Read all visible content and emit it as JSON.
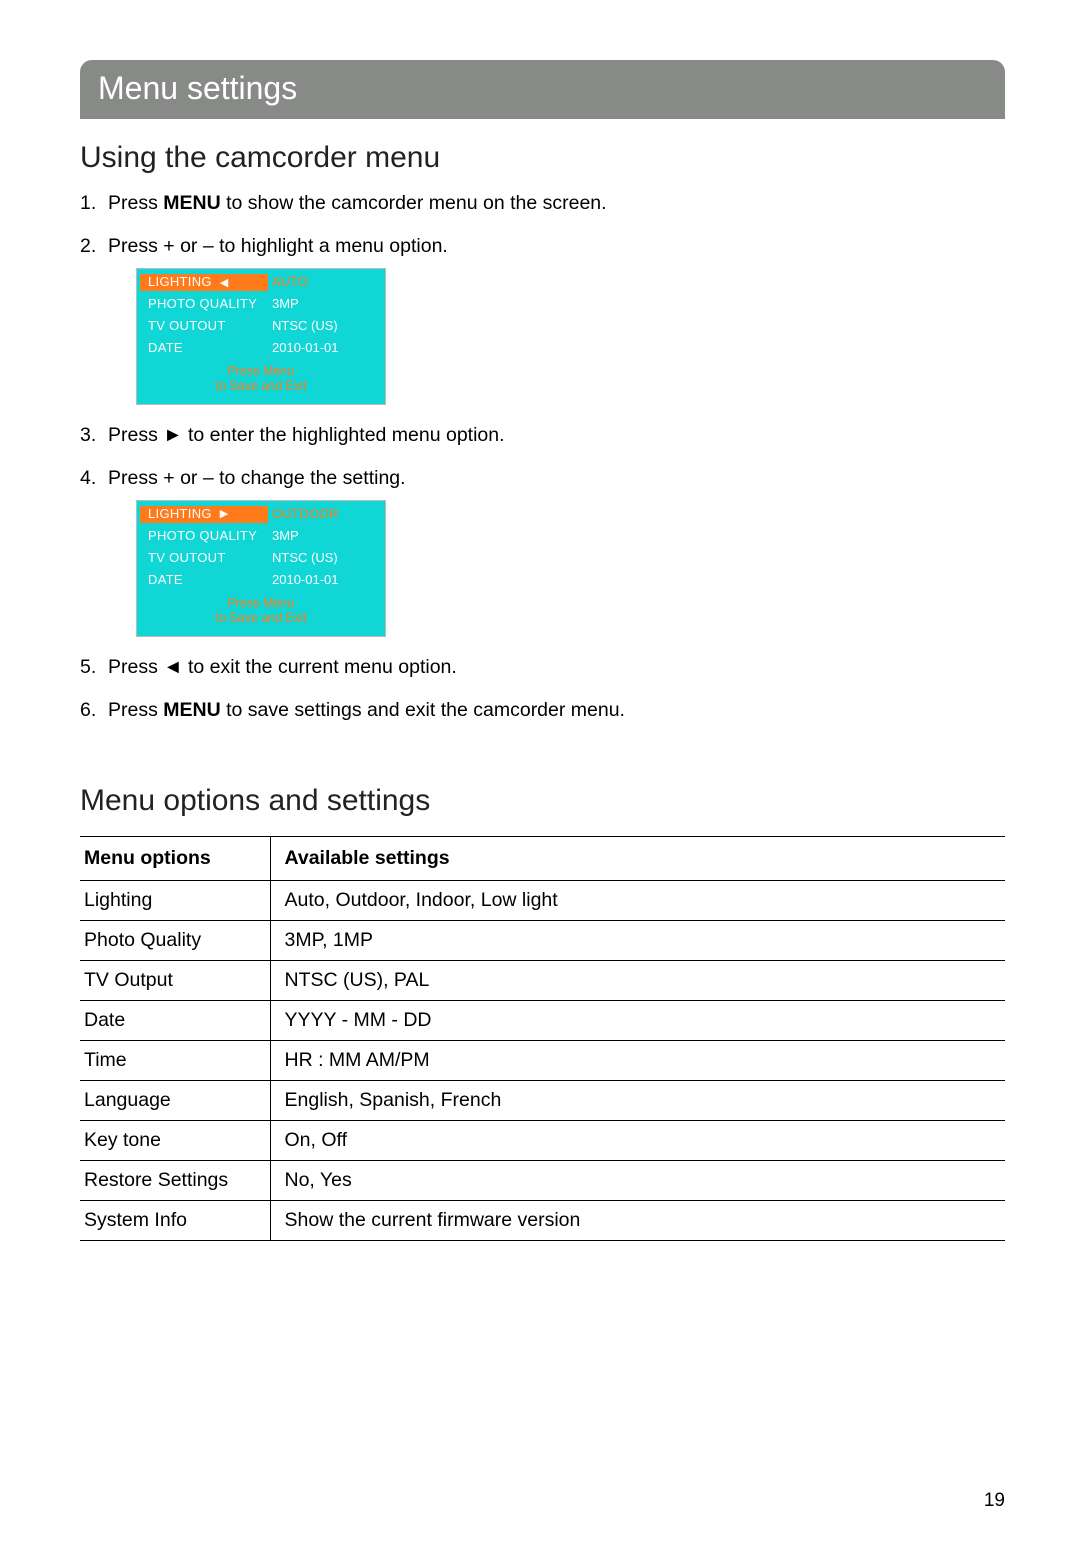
{
  "page_number": "19",
  "title_bar": "Menu settings",
  "section1_heading": "Using the camcorder menu",
  "steps": {
    "s1_pre": "Press ",
    "s1_menu": "MENU",
    "s1_post": " to show the camcorder menu on the screen.",
    "s2": "Press + or – to highlight a menu option.",
    "s3": "Press ► to enter the highlighted menu option.",
    "s4": "Press + or – to change the setting.",
    "s5": "Press ◄ to exit the current menu option.",
    "s6_pre": "Press ",
    "s6_menu": "MENU",
    "s6_post": " to save settings and exit the camcorder menu."
  },
  "cam1": {
    "r1_left": "LIGHTING",
    "r1_arrow": "◀",
    "r1_right": "AUTO",
    "r2_left": "PHOTO QUALITY",
    "r2_right": "3MP",
    "r3_left": "TV OUTOUT",
    "r3_right": "NTSC (US)",
    "r4_left": "DATE",
    "r4_right": "2010-01-01",
    "f1": "Press Menu",
    "f2": "to Save and Exit"
  },
  "cam2": {
    "r1_left": "LIGHTING",
    "r1_arrow": "▶",
    "r1_right": "OUTDOOR",
    "r2_left": "PHOTO QUALITY",
    "r2_right": "3MP",
    "r3_left": "TV OUTOUT",
    "r3_right": "NTSC (US)",
    "r4_left": "DATE",
    "r4_right": "2010-01-01",
    "f1": "Press Menu",
    "f2": "to Save and Exit"
  },
  "section2_heading": "Menu options and settings",
  "table": {
    "h1": "Menu options",
    "h2": "Available settings",
    "rows": [
      {
        "opt": "Lighting",
        "val": "Auto, Outdoor, Indoor, Low light"
      },
      {
        "opt": "Photo Quality",
        "val": "3MP, 1MP"
      },
      {
        "opt": "TV Output",
        "val": "NTSC (US), PAL"
      },
      {
        "opt": "Date",
        "val": "YYYY - MM - DD"
      },
      {
        "opt": "Time",
        "val": "HR : MM AM/PM"
      },
      {
        "opt": "Language",
        "val": "English, Spanish, French"
      },
      {
        "opt": "Key tone",
        "val": "On, Off"
      },
      {
        "opt": "Restore Settings",
        "val": "No, Yes"
      },
      {
        "opt": "System Info",
        "val": "Show the current firmware version"
      }
    ]
  }
}
